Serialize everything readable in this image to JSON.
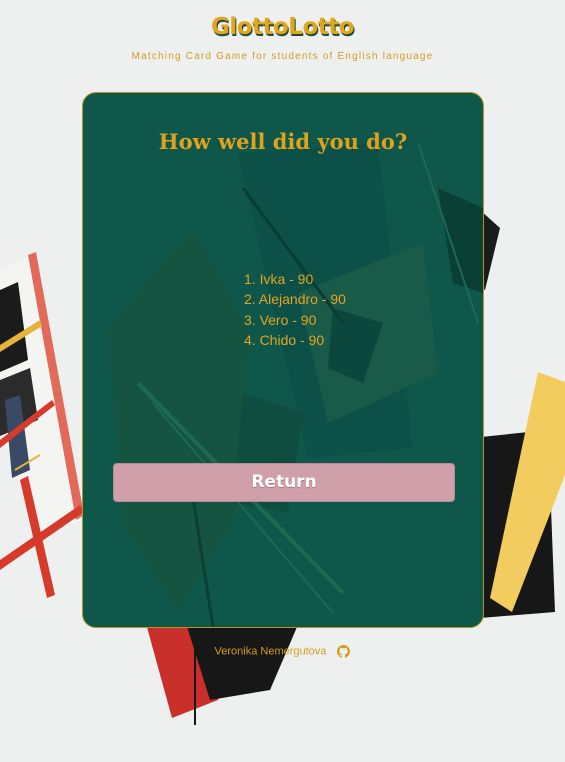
{
  "header": {
    "title": "GlottoLotto",
    "subtitle": "Matching Card Game for students of English language"
  },
  "card": {
    "heading": "How well did you do?",
    "scores": [
      "1. Ivka - 90",
      "2. Alejandro - 90",
      "3. Vero - 90",
      "4. Chido - 90"
    ],
    "return_label": "Return"
  },
  "footer": {
    "author": "Veronika Nemergutova",
    "icon": "github-icon"
  },
  "colors": {
    "accent": "#e3a51a",
    "card_bg": "#0f574a",
    "button_bg": "#cf9faa"
  }
}
